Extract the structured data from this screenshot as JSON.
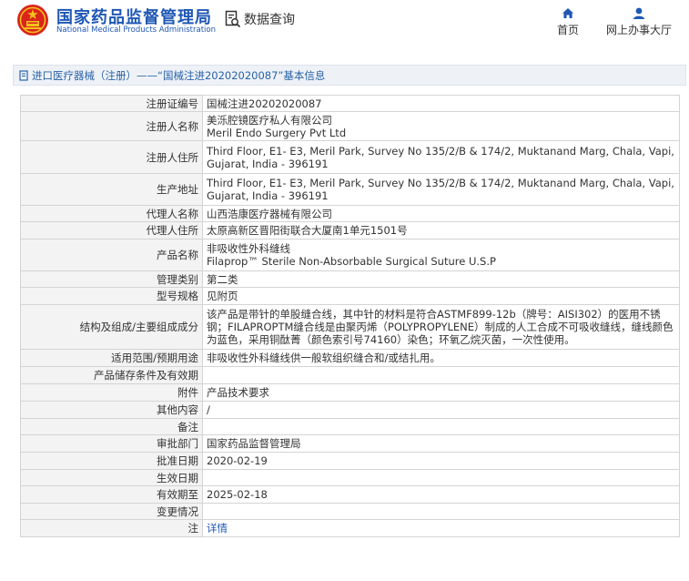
{
  "header": {
    "logo_cn": "国家药品监督管理局",
    "logo_en": "National Medical Products Administration",
    "query_label": "数据查询",
    "nav": {
      "home_label": "首页",
      "office_label": "网上办事大厅"
    }
  },
  "breadcrumb": {
    "prefix": "进口医疗器械（注册）",
    "separator": "——",
    "title": "“国械注进20202020087”基本信息"
  },
  "table": {
    "rows": [
      {
        "label": "注册证编号",
        "value": "国械注进20202020087",
        "height": 18
      },
      {
        "label": "注册人名称",
        "value": "美泺腔镜医疗私人有限公司\nMeril Endo Surgery Pvt Ltd",
        "height": 32
      },
      {
        "label": "注册人住所",
        "value": "Third Floor, E1- E3, Meril Park, Survey No 135/2/B & 174/2, Muktanand Marg, Chala, Vapi, Gujarat, India - 396191",
        "height": 36
      },
      {
        "label": "生产地址",
        "value": "Third Floor, E1- E3, Meril Park, Survey No 135/2/B & 174/2, Muktanand Marg, Chala, Vapi, Gujarat, India - 396191",
        "height": 35
      },
      {
        "label": "代理人名称",
        "value": "山西浩康医疗器械有限公司",
        "height": 18
      },
      {
        "label": "代理人住所",
        "value": "太原高新区晋阳街联合大厦南1单元1501号",
        "height": 19
      },
      {
        "label": "产品名称",
        "value": "非吸收性外科缝线\nFilaprop™ Sterile Non-Absorbable Surgical Suture U.S.P",
        "height": 35
      },
      {
        "label": "管理类别",
        "value": "第二类",
        "height": 18
      },
      {
        "label": "型号规格",
        "value": "见附页",
        "height": 19
      },
      {
        "label": "结构及组成/主要组成成分",
        "value": "该产品是带针的单股缝合线，其中针的材料是符合ASTMF899-12b（牌号：AISI302）的医用不锈钢；FILAPROPTM缝合线是由聚丙烯（POLYPROPYLENE）制成的人工合成不可吸收缝线，缝线颜色为蓝色，采用铜酞菁（颜色索引号74160）染色；环氧乙烷灭菌，一次性使用。",
        "height": 49
      },
      {
        "label": "适用范围/预期用途",
        "value": "非吸收性外科缝线供一般软组织缝合和/或结扎用。",
        "height": 19
      },
      {
        "label": "产品储存条件及有效期",
        "value": "",
        "height": 19
      },
      {
        "label": "附件",
        "value": "产品技术要求",
        "height": 19
      },
      {
        "label": "其他内容",
        "value": "/",
        "height": 19
      },
      {
        "label": "备注",
        "value": "",
        "height": 18
      },
      {
        "label": "审批部门",
        "value": "国家药品监督管理局",
        "height": 19
      },
      {
        "label": "批准日期",
        "value": "2020-02-19",
        "height": 19
      },
      {
        "label": "生效日期",
        "value": "",
        "height": 18
      },
      {
        "label": "有效期至",
        "value": "2025-02-18",
        "height": 19
      },
      {
        "label": "变更情况",
        "value": "",
        "height": 18
      },
      {
        "label": "注",
        "value": "详情",
        "height": 19,
        "link": true
      }
    ]
  },
  "colors": {
    "brand_blue": "#1f57b4",
    "emblem_red": "#d9251c",
    "emblem_gold": "#f4c21b"
  }
}
